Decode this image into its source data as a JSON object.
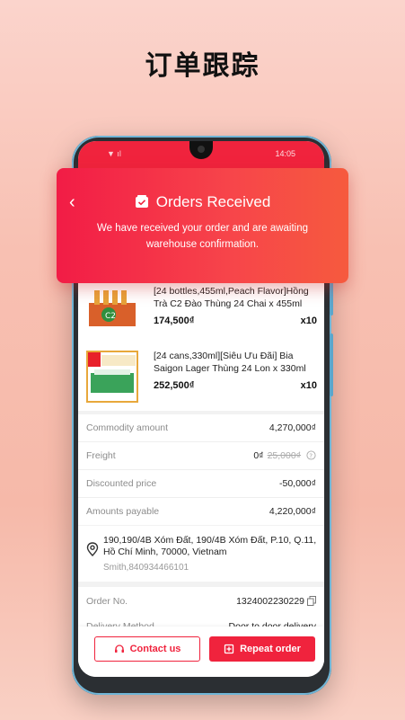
{
  "headline": "订单跟踪",
  "status_bar": {
    "left": "▼ ıl",
    "time": "14:05"
  },
  "banner": {
    "title": "Orders Received",
    "description": "We have received your order and are awaiting warehouse confirmation."
  },
  "products": [
    {
      "title": "[24 bottles,455ml,Peach Flavor]Hồng Trà C2 Đào Thùng 24 Chai x 455ml",
      "price": "174,500₫",
      "qty": "x10"
    },
    {
      "title": "[24 cans,330ml][Siêu Ưu Đãi] Bia Saigon Lager Thùng 24 Lon x 330ml",
      "price": "252,500₫",
      "qty": "x10"
    }
  ],
  "summary": {
    "commodity_label": "Commodity amount",
    "commodity_value": "4,270,000₫",
    "freight_label": "Freight",
    "freight_value": "0₫",
    "freight_original": "25,000₫",
    "discount_label": "Discounted price",
    "discount_value": "-50,000₫",
    "payable_label": "Amounts payable",
    "payable_value": "4,220,000₫"
  },
  "address": {
    "line": "190,190/4B Xóm Đất, 190/4B Xóm Đất, P.10, Q.11, Hồ Chí Minh, 70000, Vietnam",
    "user": "Smith,840934466101"
  },
  "order": {
    "no_label": "Order No.",
    "no_value": "1324002230229",
    "delivery_label": "Delivery Method",
    "delivery_value": "Door to door delivery"
  },
  "actions": {
    "contact": "Contact us",
    "repeat": "Repeat order"
  },
  "colors": {
    "accent": "#f0233d"
  }
}
